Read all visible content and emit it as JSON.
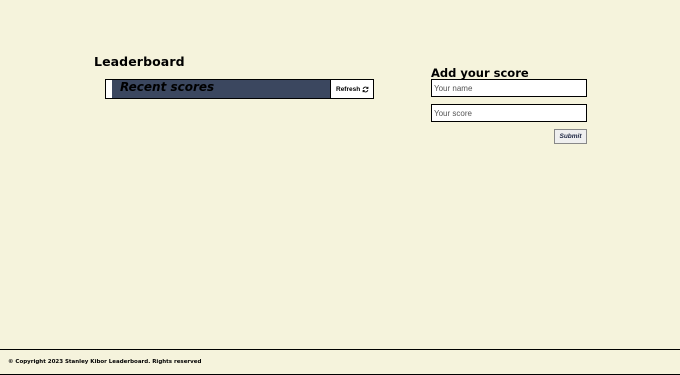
{
  "leaderboard": {
    "title": "Leaderboard",
    "recent_scores_title": "Recent scores",
    "refresh_label": "Refresh",
    "refresh_icon": "refresh-icon",
    "bar_color": "#3b475f"
  },
  "form": {
    "title": "Add your score",
    "name_placeholder": "Your name",
    "name_value": "",
    "score_placeholder": "Your score",
    "score_value": "",
    "submit_label": "Submit"
  },
  "footer": {
    "copyright": "© Copyright 2023 Stanley Kibor Leaderboard. Rights reserved"
  },
  "colors": {
    "background": "#f5f3dc",
    "accent": "#3b475f"
  }
}
